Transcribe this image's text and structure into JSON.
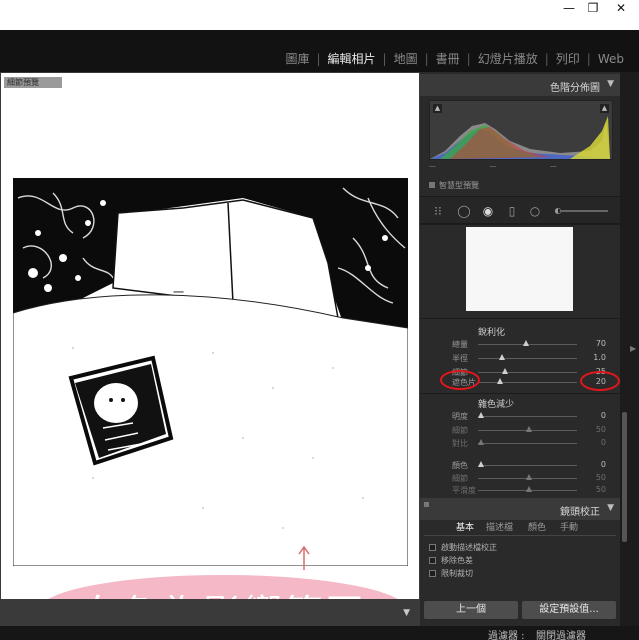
{
  "window": {
    "minimize_glyph": "—",
    "restore_glyph": "❐",
    "close_glyph": "✕"
  },
  "modules": [
    "圖庫",
    "編輯相片",
    "地圖",
    "書冊",
    "幻燈片播放",
    "列印",
    "Web"
  ],
  "active_module": "編輯相片",
  "photo_panel": {
    "tag": "細節預覽",
    "annotation": "白色為影響範圍",
    "annotation_color": "#f4b8c6"
  },
  "histogram": {
    "title": "色階分佈圖",
    "smart_preview": "智慧型預覽"
  },
  "detail": {
    "sharpen": {
      "title": "銳利化",
      "rows": [
        {
          "label": "總量",
          "value": "70",
          "level": 0.47
        },
        {
          "label": "半徑",
          "value": "1.0",
          "level": 0.22
        },
        {
          "label": "細節",
          "value": "25",
          "level": 0.25
        },
        {
          "label": "遮色片",
          "value": "20",
          "level": 0.2
        }
      ]
    },
    "noise": {
      "title": "雜色減少",
      "rows": [
        {
          "label": "明度",
          "value": "0",
          "level": 0.0
        },
        {
          "label": "細節",
          "value": "50",
          "level": 0.5
        },
        {
          "label": "對比",
          "value": "0",
          "level": 0.0
        },
        {
          "label": "顏色",
          "value": "0",
          "level": 0.0
        },
        {
          "label": "細節",
          "value": "50",
          "level": 0.5
        },
        {
          "label": "平滑度",
          "value": "50",
          "level": 0.5
        }
      ]
    }
  },
  "lens": {
    "title": "鏡頭校正",
    "tabs": [
      "基本",
      "描述檔",
      "顏色",
      "手動"
    ],
    "active_tab": "基本",
    "checkboxes": [
      "啟動描述檔校正",
      "移除色差",
      "限制裁切"
    ]
  },
  "buttons": {
    "prev": "上一個",
    "set_default": "設定預設值..."
  },
  "filter": {
    "label": "過濾器 :",
    "value": "關閉過濾器"
  },
  "colors": {
    "panel_bg": "#2a2a2a",
    "highlight_ring": "#e0161b",
    "module_active": "#e8e8e8"
  }
}
